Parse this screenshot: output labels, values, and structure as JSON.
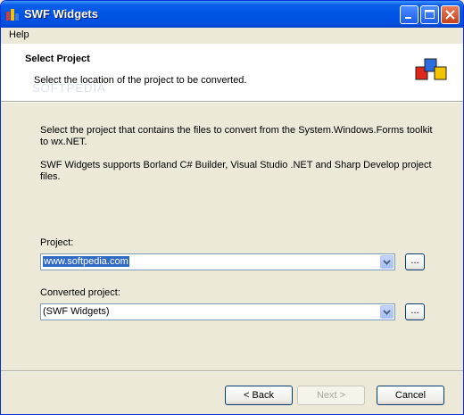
{
  "window": {
    "title": "SWF Widgets",
    "menu": [
      "Help"
    ],
    "watermark": "SOFTPEDIA"
  },
  "header": {
    "title": "Select Project",
    "description": "Select the location of the project to be converted."
  },
  "body": {
    "intro_text": "Select the project that contains the files to convert from the System.Windows.Forms toolkit to wx.NET.",
    "supports_text": "SWF Widgets supports Borland C# Builder, Visual Studio .NET and Sharp Develop project files."
  },
  "fields": {
    "project_label": "Project:",
    "project_value": "www.softpedia.com",
    "converted_label": "Converted project:",
    "converted_value": "(SWF Widgets)",
    "browse_label": "..."
  },
  "buttons": {
    "back": "< Back",
    "next": "Next >",
    "cancel": "Cancel"
  },
  "colors": {
    "titlebar": "#0054E3",
    "dialog_bg": "#ECE9D8",
    "selection": "#316AC5"
  }
}
